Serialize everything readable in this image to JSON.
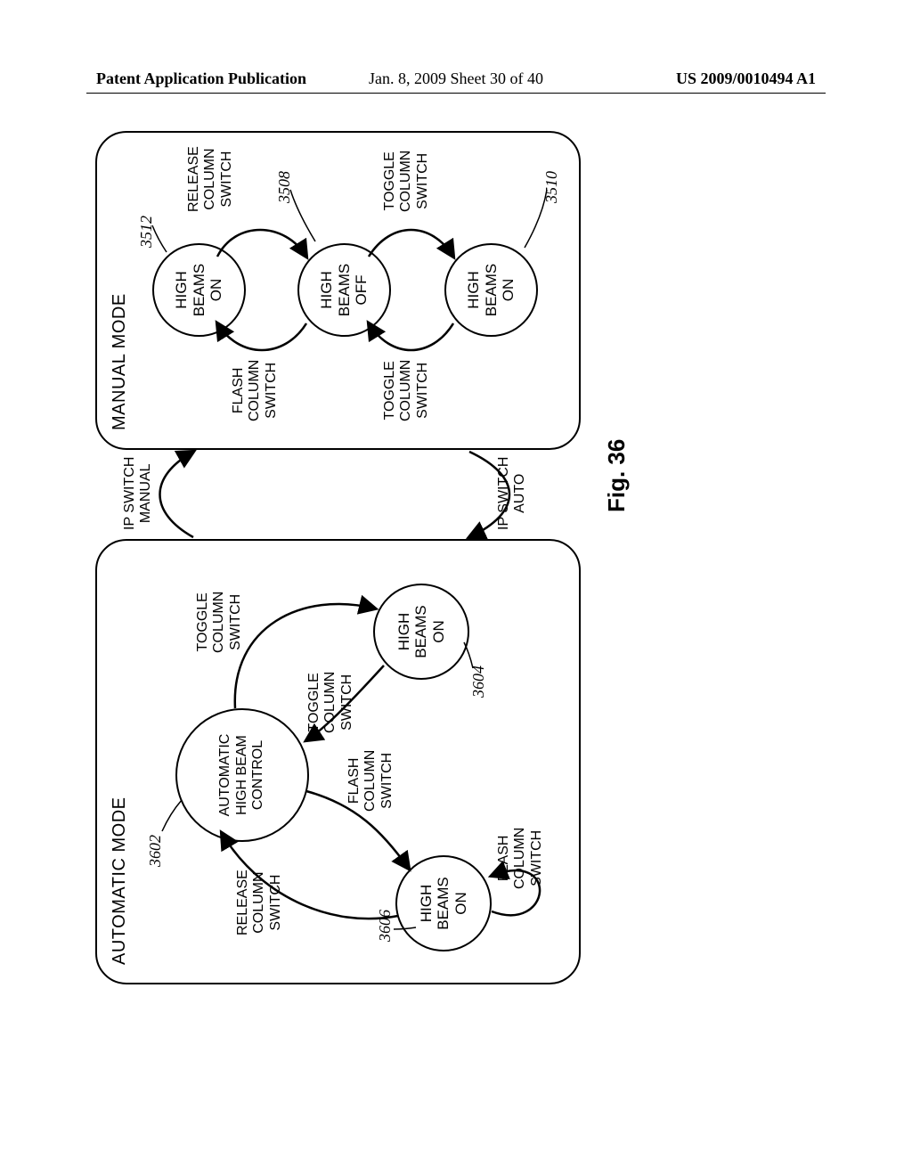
{
  "header": {
    "left": "Patent Application Publication",
    "mid": "Jan. 8, 2009  Sheet 30 of 40",
    "right": "US 2009/0010494 A1"
  },
  "figure_label": "Fig. 36",
  "panels": {
    "auto": {
      "title": "AUTOMATIC MODE"
    },
    "manual": {
      "title": "MANUAL MODE"
    }
  },
  "states": {
    "auto_ctrl": "AUTOMATIC\nHIGH BEAM\nCONTROL",
    "hb_on": "HIGH\nBEAMS\nON",
    "hb_off": "HIGH\nBEAMS\nOFF"
  },
  "transitions": {
    "toggle": "TOGGLE\nCOLUMN\nSWITCH",
    "flash": "FLASH\nCOLUMN\nSWITCH",
    "release": "RELEASE\nCOLUMN\nSWITCH",
    "ip_manual": "IP SWITCH\nMANUAL",
    "ip_auto": "IP SWITCH\nAUTO"
  },
  "refs": {
    "r3602": "3602",
    "r3604": "3604",
    "r3606": "3606",
    "r3512": "3512",
    "r3508": "3508",
    "r3510": "3510"
  }
}
